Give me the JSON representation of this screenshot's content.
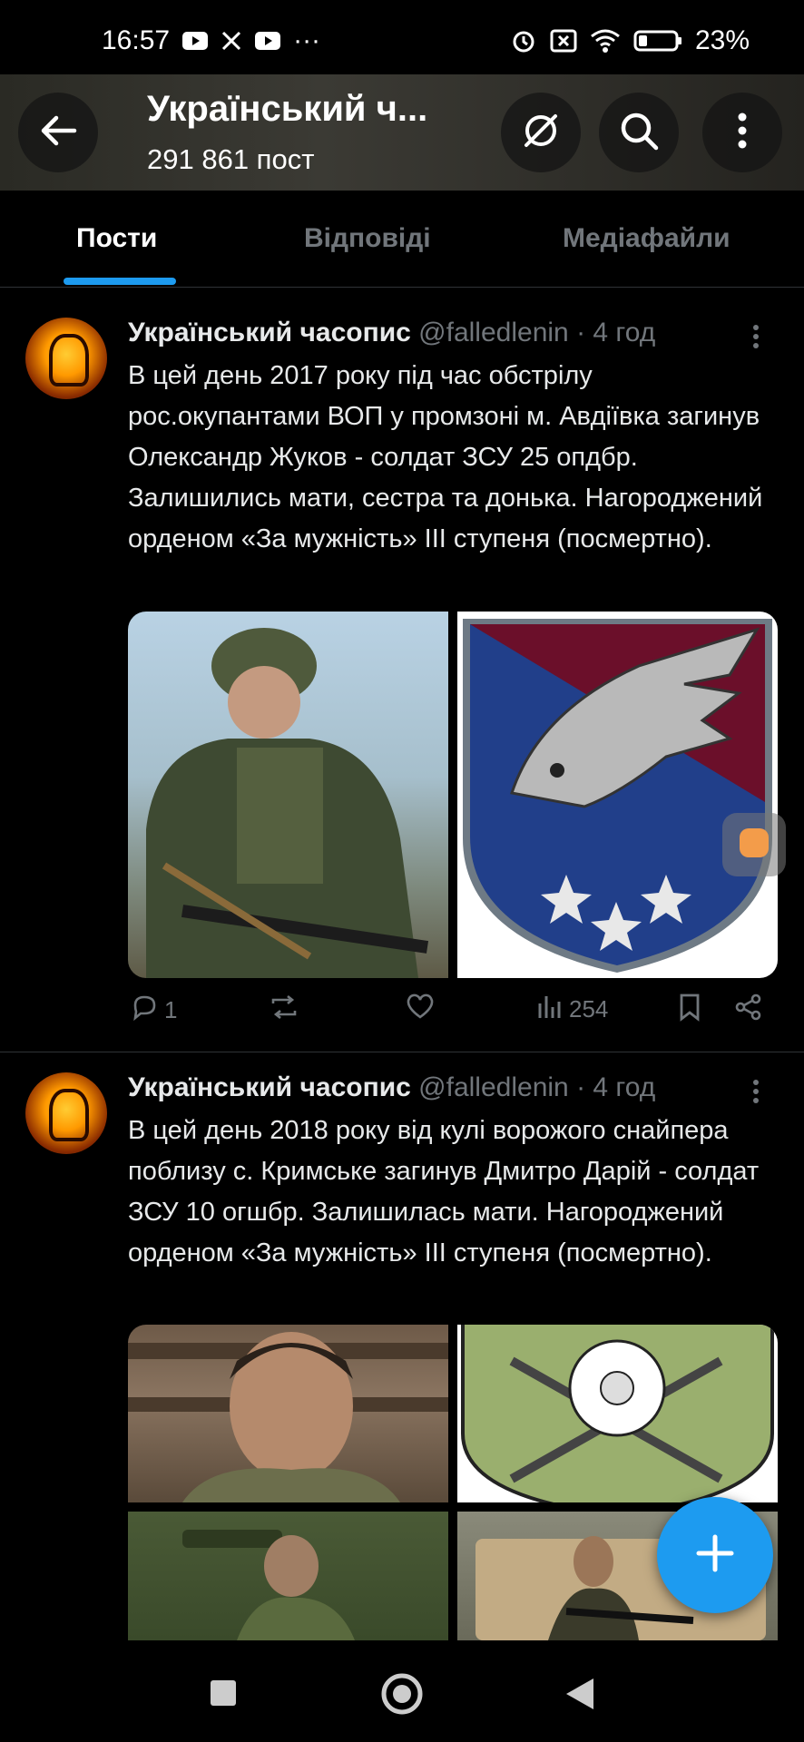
{
  "status_bar": {
    "time": "16:57",
    "dots": "···",
    "battery": "23%",
    "icons": [
      "youtube-icon",
      "x-icon",
      "youtube-icon",
      "alarm-icon",
      "close-box-icon",
      "wifi-icon",
      "battery-icon"
    ]
  },
  "header": {
    "title": "Український ч...",
    "post_count": "291 861 пост"
  },
  "tabs": [
    {
      "label": "Пости",
      "active": true
    },
    {
      "label": "Відповіді",
      "active": false
    },
    {
      "label": "Медіафайли",
      "active": false
    }
  ],
  "posts": [
    {
      "name": "Український часопис",
      "handle": "@falledlenin",
      "time": "· 4 год",
      "text": "В цей день 2017 року під час обстрілу рос.окупантами ВОП у промзоні м. Авдіївка загинув Олександр Жуков - солдат ЗСУ 25 опдбр. Залишились мати, сестра та донька. Нагороджений орденом «За мужність» ІІІ ступеня (посмертно).",
      "replies": "1",
      "views": "254"
    },
    {
      "name": "Український часопис",
      "handle": "@falledlenin",
      "time": "· 4 год",
      "text": "В цей день 2018 року від кулі ворожого снайпера поблизу с. Кримське загинув Дмитро Дарій - солдат ЗСУ 10 огшбр. Залишилась мати. Нагороджений орденом «За мужність» ІІІ ступеня (посмертно)."
    }
  ],
  "colors": {
    "accent": "#1d9bf0",
    "background": "#000000",
    "muted": "#71767b"
  }
}
